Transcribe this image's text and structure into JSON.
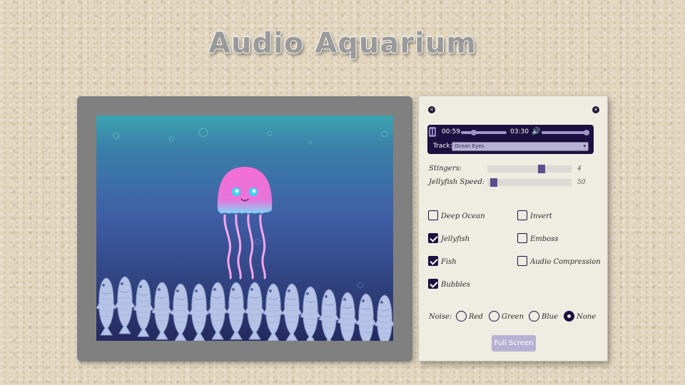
{
  "app": {
    "title": "Audio Aquarium"
  },
  "player": {
    "current_time": "00:59",
    "duration": "03:30",
    "seek_progress": 0.28,
    "volume_level": 0.98,
    "track_label": "Track:",
    "track_selected": "Ocean Eyes"
  },
  "sliders": [
    {
      "label": "Stingers:",
      "value": "4",
      "fraction": 0.66
    },
    {
      "label": "Jellyfish Speed:",
      "value": "50",
      "fraction": 0.04
    }
  ],
  "options_left": [
    {
      "label": "Deep Ocean",
      "checked": false
    },
    {
      "label": "Jellyfish",
      "checked": true
    },
    {
      "label": "Fish",
      "checked": true
    },
    {
      "label": "Bubbles",
      "checked": true
    }
  ],
  "options_right": [
    {
      "label": "Invert",
      "checked": false
    },
    {
      "label": "Emboss",
      "checked": false
    },
    {
      "label": "Audio Compression",
      "checked": false
    }
  ],
  "noise": {
    "label": "Noise:",
    "options": [
      "Red",
      "Green",
      "Blue",
      "None"
    ],
    "selected": "None"
  },
  "buttons": {
    "fullscreen": "Full Screen"
  },
  "colors": {
    "panel_bg": "#efece2",
    "accent": "#1c1040",
    "jellyfish": "#f06fd6",
    "jellyfish_glow": "#7fd9f5",
    "water_top": "#3aa4b0",
    "water_bottom": "#24295e",
    "fish": "#b4c3e6"
  },
  "icons": {
    "close_left": "close-icon",
    "close_right": "close-icon",
    "play_pause": "pause-icon",
    "volume": "speaker-icon",
    "dropdown": "chevron-down-icon"
  }
}
